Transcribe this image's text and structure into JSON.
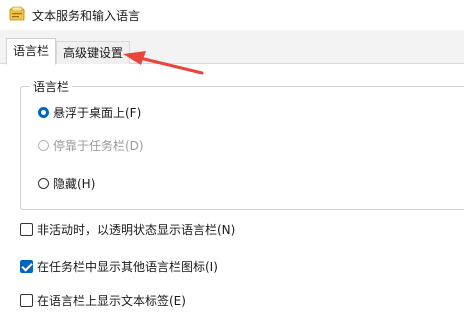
{
  "window": {
    "title": "文本服务和输入语言",
    "icon": "text-services-icon"
  },
  "tabs": [
    {
      "label": "语言栏",
      "active": true
    },
    {
      "label": "高级键设置",
      "active": false
    }
  ],
  "language_bar_group": {
    "legend": "语言栏",
    "options": [
      {
        "label": "悬浮于桌面上(F)",
        "checked": true,
        "enabled": true
      },
      {
        "label": "停靠于任务栏(D)",
        "checked": false,
        "enabled": false
      },
      {
        "label": "隐藏(H)",
        "checked": false,
        "enabled": true
      }
    ]
  },
  "checkboxes": [
    {
      "label": "非活动时，以透明状态显示语言栏(N)",
      "checked": false
    },
    {
      "label": "在任务栏中显示其他语言栏图标(I)",
      "checked": true
    },
    {
      "label": "在语言栏上显示文本标签(E)",
      "checked": false
    }
  ],
  "annotation": {
    "icon": "red-arrow-icon",
    "color": "#e8453c"
  }
}
